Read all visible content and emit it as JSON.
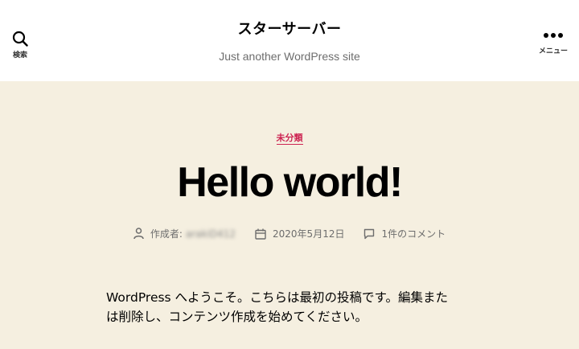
{
  "header": {
    "search_label": "検索",
    "menu_label": "メニュー",
    "site_title": "スターサーバー",
    "site_description": "Just another WordPress site"
  },
  "post": {
    "category": "未分類",
    "title": "Hello world!",
    "author_label": "作成者:",
    "author_name": "arakiD412",
    "date": "2020年5月12日",
    "comments": "1件のコメント",
    "content_line1": "WordPress へようこそ。こちらは最初の投稿です。編集また",
    "content_line2": "は削除し、コンテンツ作成を始めてください。"
  },
  "colors": {
    "accent": "#cd2653",
    "background": "#f5efe0",
    "header_bg": "#ffffff",
    "meta_text": "#6d6d6d"
  }
}
